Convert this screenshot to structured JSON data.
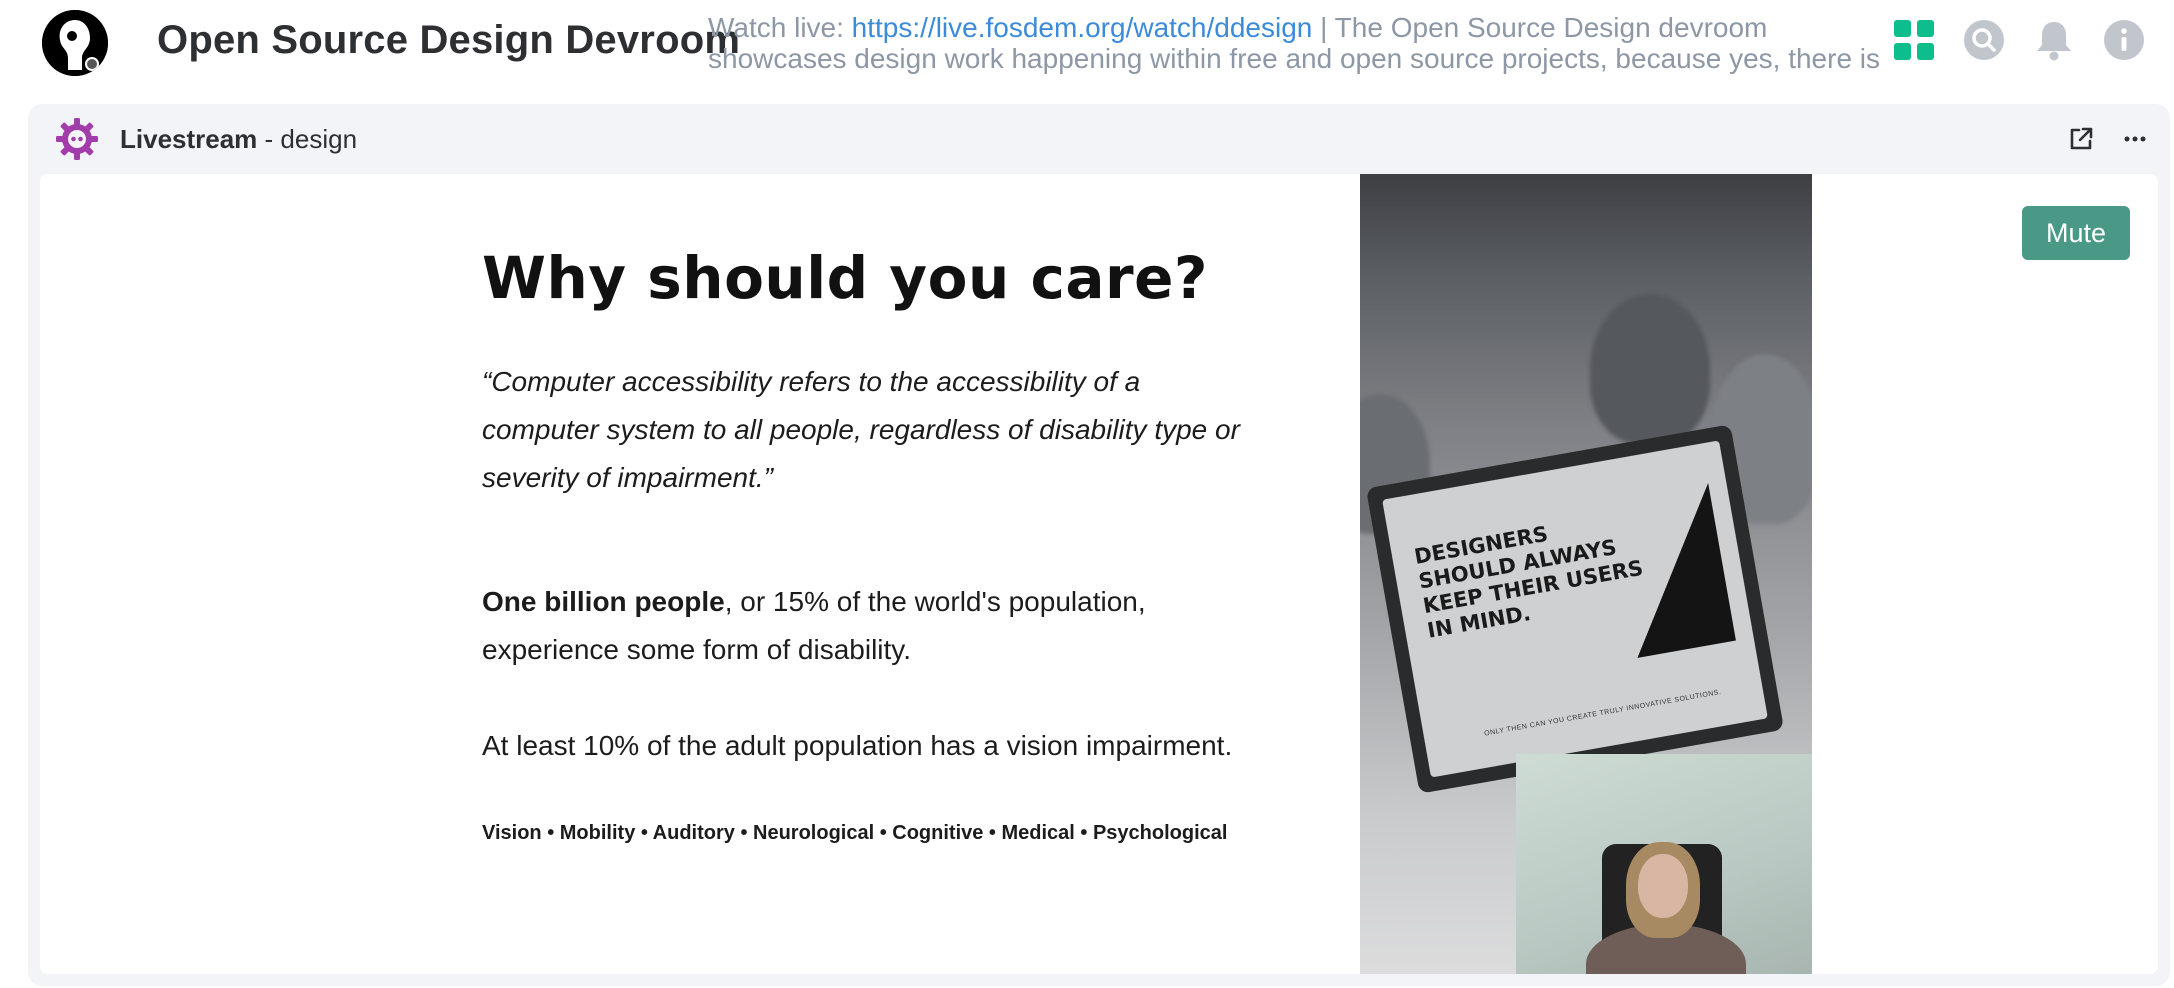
{
  "header": {
    "room_name": "Open Source Design Devroom",
    "topic_prefix": "Watch live: ",
    "topic_link": "https://live.fosdem.org/watch/ddesign",
    "topic_rest": " | The Open Source Design devroom showcases design work happening within free and open source projects, because yes, there is",
    "icons": [
      "apps-icon",
      "search-icon",
      "bell-icon",
      "info-icon"
    ]
  },
  "widget": {
    "name": "Livestream",
    "separator": " - ",
    "context": "design",
    "actions": [
      "popout-icon",
      "more-icon"
    ]
  },
  "slide": {
    "heading": "Why should you care?",
    "quote": "“Computer accessibility refers to the accessibility of a computer system to all people, regardless of disability type or severity of impairment.”",
    "para1_bold": "One billion people",
    "para1_rest": ", or 15% of the world's population, experience some form of disability.",
    "para2": "At least 10% of the adult population has a vision impairment.",
    "categories": "Vision • Mobility • Auditory • Neurological •  Cognitive • Medical • Psychological"
  },
  "photo": {
    "monitor_text": "DESIGNERS SHOULD ALWAYS KEEP THEIR USERS IN MIND.",
    "monitor_footer": "ONLY THEN CAN YOU CREATE TRULY INNOVATIVE SOLUTIONS."
  },
  "controls": {
    "mute_label": "Mute"
  },
  "colors": {
    "accent": "#0dbd8b",
    "mute_bg": "#4a9987",
    "link": "#3c8bd9",
    "topic_text": "#8d97a5",
    "widget_bg": "#f2f4f7",
    "widget_icon": "#a23caa"
  }
}
